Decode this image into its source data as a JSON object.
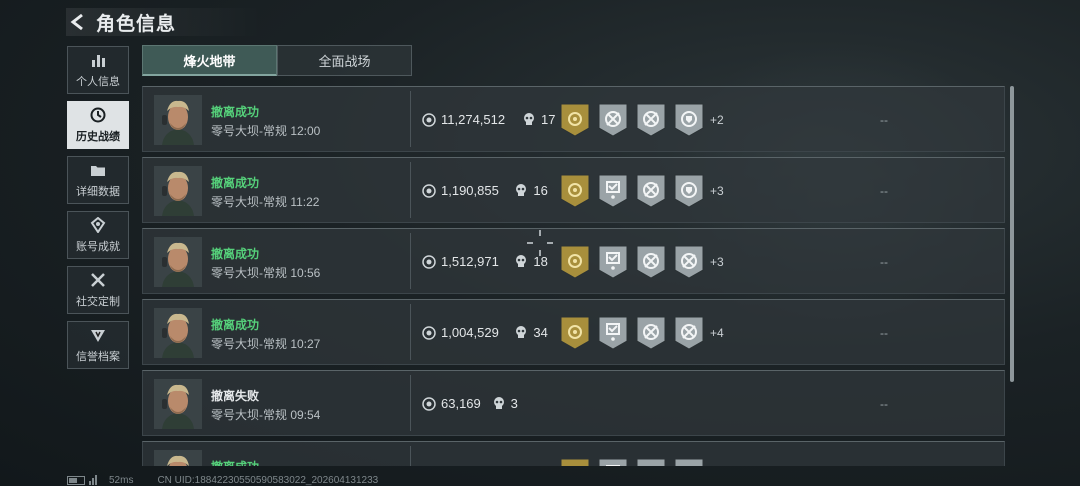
{
  "header": {
    "title": "角色信息"
  },
  "nav": [
    {
      "label": "个人信息",
      "icon": "bar-chart-icon",
      "active": false
    },
    {
      "label": "历史战绩",
      "icon": "history-icon",
      "active": true
    },
    {
      "label": "详细数据",
      "icon": "folder-icon",
      "active": false
    },
    {
      "label": "账号成就",
      "icon": "achievement-icon",
      "active": false
    },
    {
      "label": "社交定制",
      "icon": "tools-icon",
      "active": false
    },
    {
      "label": "信誉档案",
      "icon": "credit-shield-icon",
      "active": false
    }
  ],
  "tabs": [
    {
      "label": "烽火地带",
      "active": true
    },
    {
      "label": "全面战场",
      "active": false
    }
  ],
  "matches": [
    {
      "status": "撤离成功",
      "result": "ok",
      "map_time": "零号大坝-常规 12:00",
      "value": "11,274,512",
      "kills": "17",
      "badges": [
        "gold-medal",
        "ring-cross",
        "ring-cross",
        "ring-shield"
      ],
      "extra": "+2",
      "note": "--"
    },
    {
      "status": "撤离成功",
      "result": "ok",
      "map_time": "零号大坝-常规 11:22",
      "value": "1,190,855",
      "kills": "16",
      "badges": [
        "gold-medal",
        "check-star",
        "ring-cross",
        "ring-shield"
      ],
      "extra": "+3",
      "note": "--"
    },
    {
      "status": "撤离成功",
      "result": "ok",
      "map_time": "零号大坝-常规 10:56",
      "value": "1,512,971",
      "kills": "18",
      "badges": [
        "gold-medal",
        "check-star",
        "ring-cross",
        "ring-cross"
      ],
      "extra": "+3",
      "note": "--"
    },
    {
      "status": "撤离成功",
      "result": "ok",
      "map_time": "零号大坝-常规 10:27",
      "value": "1,004,529",
      "kills": "34",
      "badges": [
        "gold-medal",
        "check-star",
        "ring-cross",
        "ring-cross"
      ],
      "extra": "+4",
      "note": "--"
    },
    {
      "status": "撤离失败",
      "result": "fail",
      "map_time": "零号大坝-常规 09:54",
      "value": "63,169",
      "kills": "3",
      "badges": [],
      "extra": "",
      "note": "--"
    },
    {
      "status": "撤离成功",
      "result": "ok",
      "map_time": "",
      "value": "",
      "kills": "",
      "badges": [
        "gold-medal",
        "check-star",
        "ring-cross",
        "ring-cross"
      ],
      "extra": "",
      "note": ""
    }
  ],
  "footer": {
    "ping": "52ms",
    "uid": "CN UID:18842230550590583022_202604131233"
  },
  "colors": {
    "success": "#55d07a",
    "gold": "#a88f3c",
    "silver": "#9aa3a7",
    "tab_active": "#3f5a56"
  }
}
